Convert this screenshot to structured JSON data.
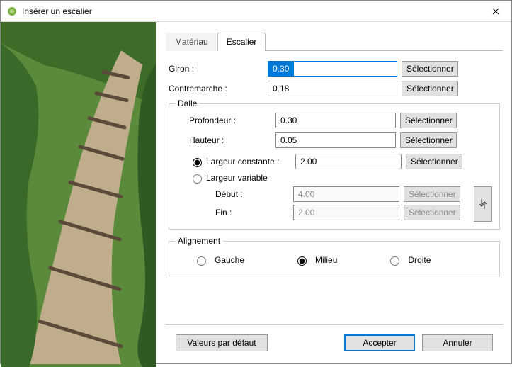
{
  "window": {
    "title": "Insérer un escalier"
  },
  "tabs": {
    "material": "Matériau",
    "stair": "Escalier",
    "active": "stair"
  },
  "fields": {
    "giron": {
      "label": "Giron :",
      "value": "0.30",
      "select": "Sélectionner"
    },
    "contremarche": {
      "label": "Contremarche :",
      "value": "0.18",
      "select": "Sélectionner"
    }
  },
  "dalle": {
    "legend": "Dalle",
    "profondeur": {
      "label": "Profondeur :",
      "value": "0.30",
      "select": "Sélectionner"
    },
    "hauteur": {
      "label": "Hauteur :",
      "value": "0.05",
      "select": "Sélectionner"
    },
    "width_mode": "constante",
    "constante": {
      "label": "Largeur constante :",
      "value": "2.00",
      "select": "Sélectionner"
    },
    "variable": {
      "label": "Largeur variable",
      "debut": {
        "label": "Début :",
        "value": "4.00",
        "select": "Sélectionner"
      },
      "fin": {
        "label": "Fin :",
        "value": "2.00",
        "select": "Sélectionner"
      }
    }
  },
  "alignement": {
    "legend": "Alignement",
    "gauche": "Gauche",
    "milieu": "Milieu",
    "droite": "Droite",
    "value": "milieu"
  },
  "footer": {
    "defaults": "Valeurs par défaut",
    "accept": "Accepter",
    "cancel": "Annuler"
  }
}
